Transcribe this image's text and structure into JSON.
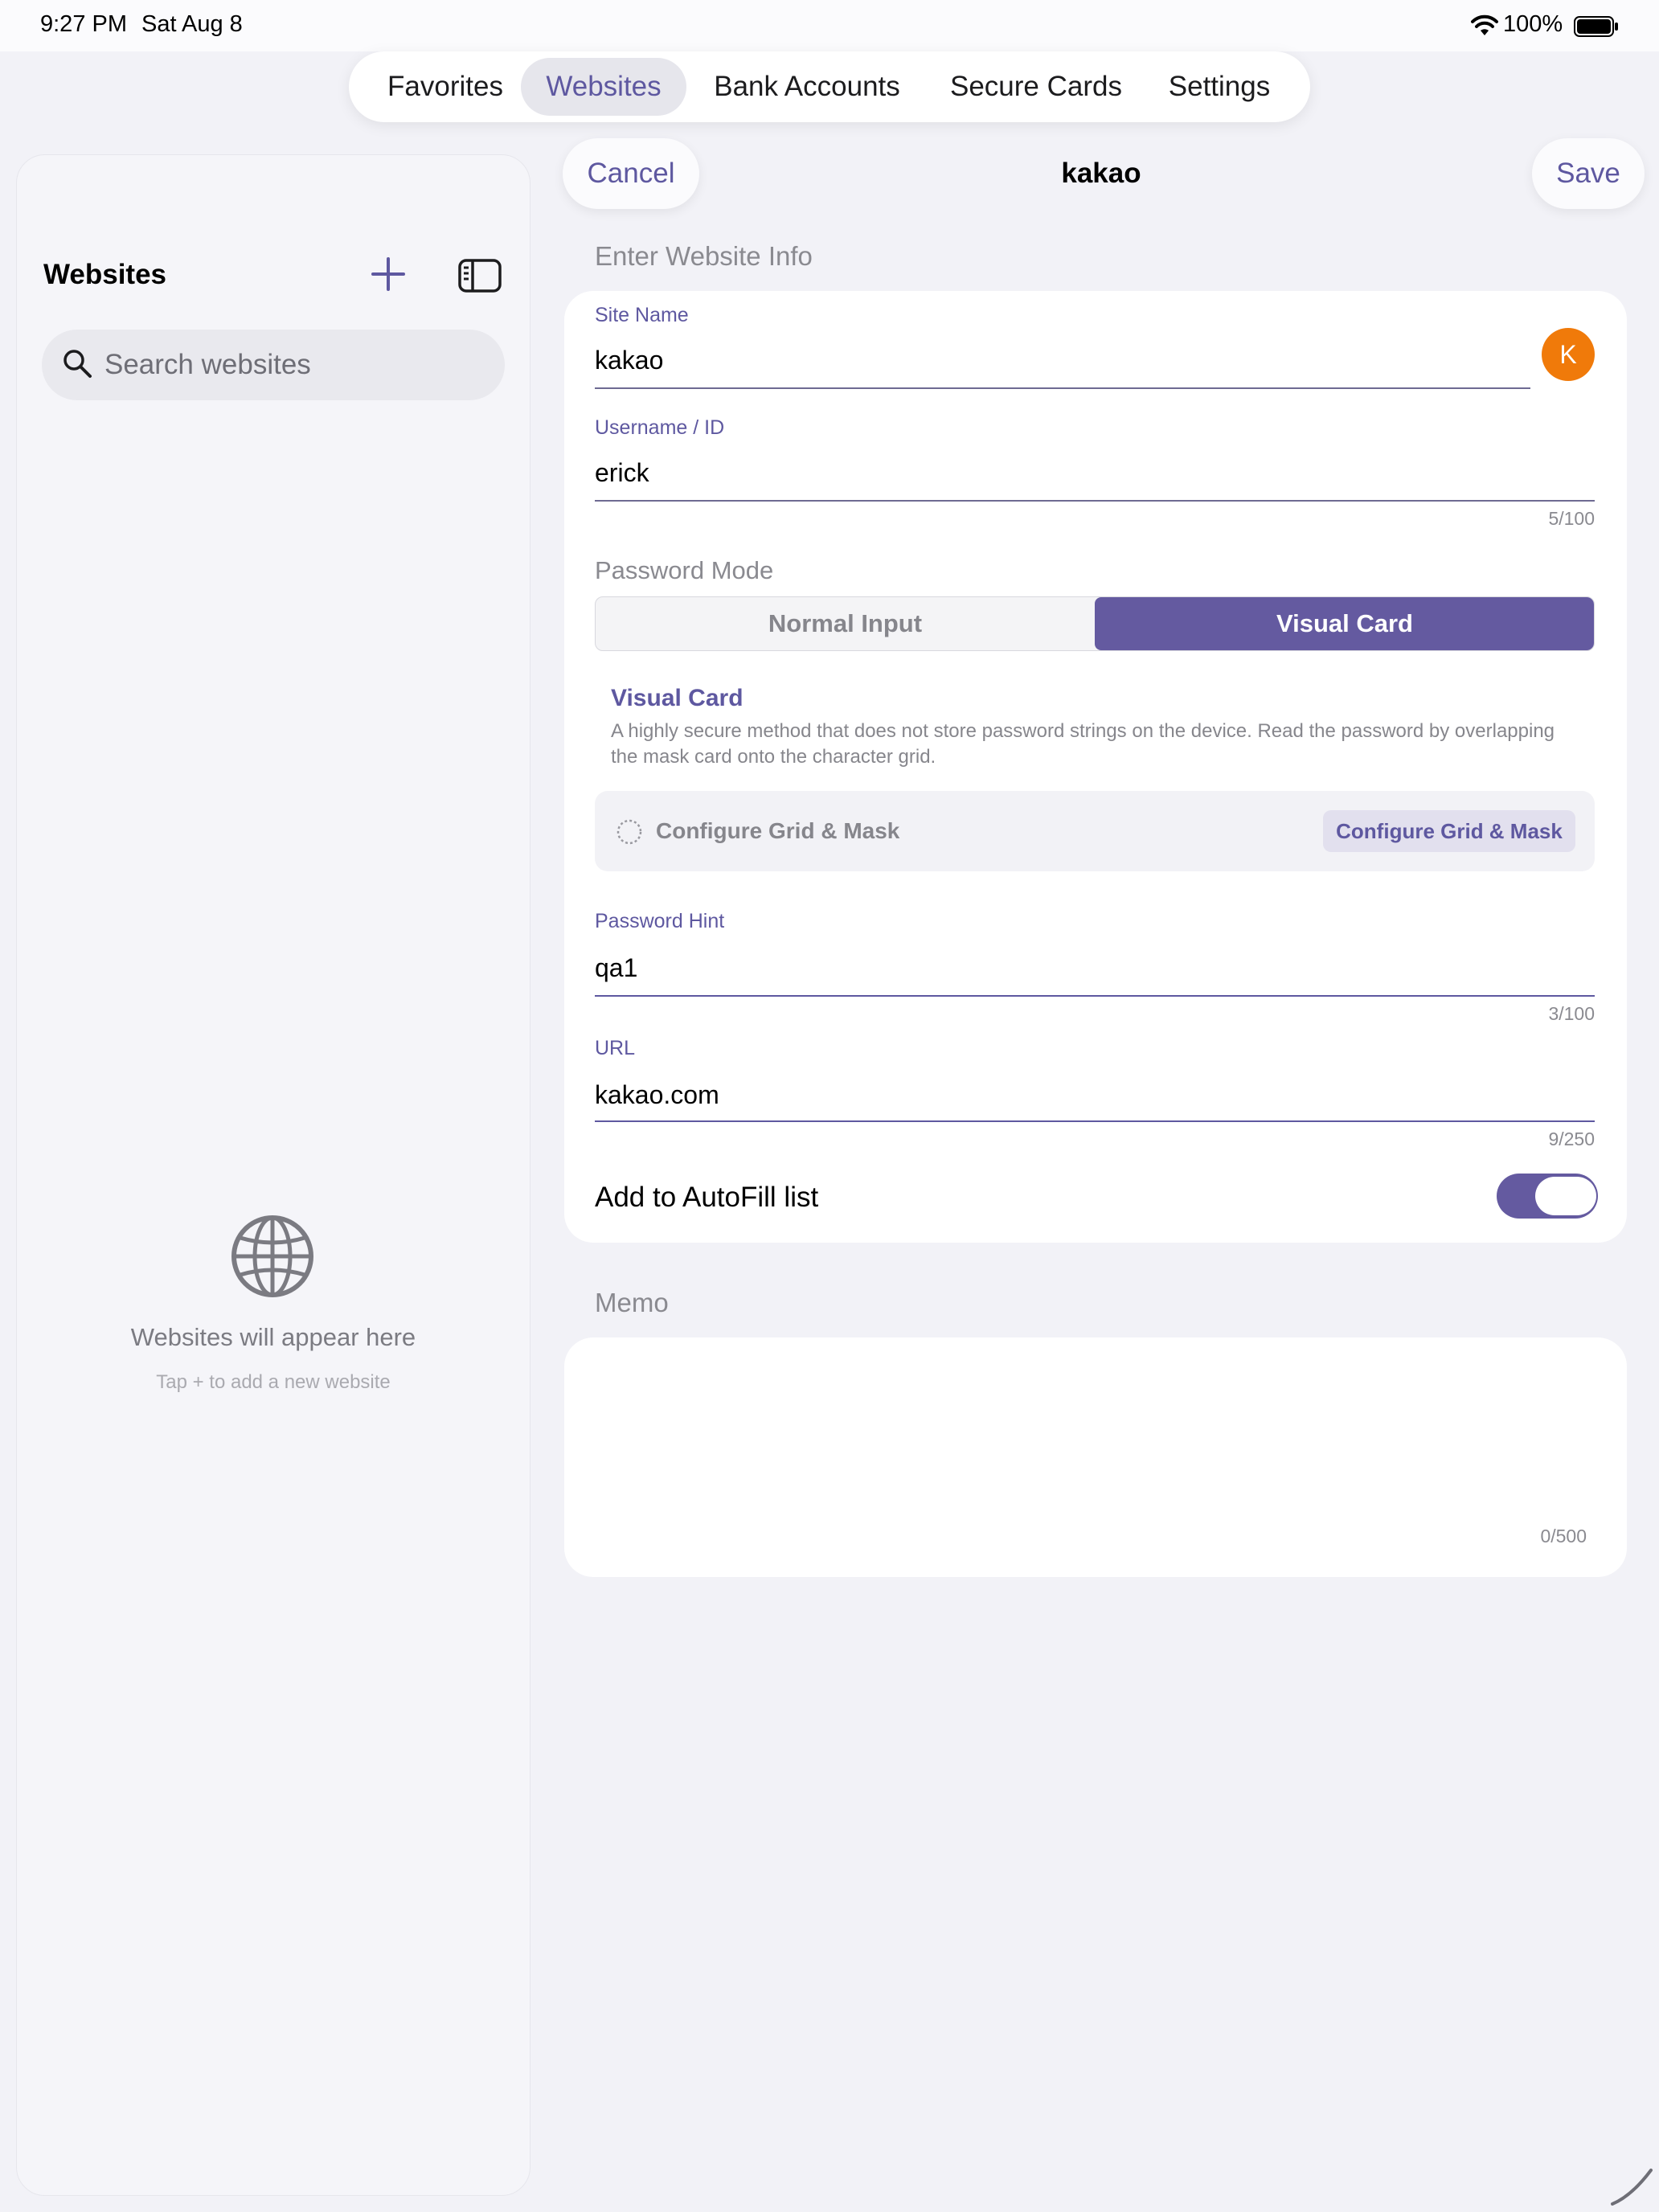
{
  "status_bar": {
    "time": "9:27 PM",
    "date": "Sat Aug 8",
    "battery": "100%",
    "wifi_icon": "wifi-icon",
    "battery_icon": "battery-full-icon"
  },
  "tabs": [
    {
      "label": "Favorites",
      "active": false
    },
    {
      "label": "Websites",
      "active": true
    },
    {
      "label": "Bank Accounts",
      "active": false
    },
    {
      "label": "Secure Cards",
      "active": false
    },
    {
      "label": "Settings",
      "active": false
    }
  ],
  "sidebar": {
    "title": "Websites",
    "add_icon": "plus-icon",
    "toggle_icon": "sidebar-toggle-icon",
    "search_placeholder": "Search websites",
    "empty_icon": "globe-icon",
    "empty_title": "Websites will appear here",
    "empty_subtitle": "Tap + to add a new website"
  },
  "nav": {
    "cancel_label": "Cancel",
    "title": "kakao",
    "save_label": "Save"
  },
  "form": {
    "section_title": "Enter Website Info",
    "site_name": {
      "label": "Site Name",
      "value": "kakao",
      "avatar_letter": "K"
    },
    "username": {
      "label": "Username / ID",
      "value": "erick",
      "counter": "5/100"
    },
    "password_mode": {
      "label": "Password Mode",
      "options": [
        "Normal Input",
        "Visual Card"
      ],
      "selected": "Visual Card"
    },
    "visual_card": {
      "title": "Visual Card",
      "description": "A highly secure method that does not store password strings on the device. Read the password by overlapping the mask card onto the character grid.",
      "status_label": "Configure Grid & Mask",
      "button_label": "Configure Grid & Mask"
    },
    "password_hint": {
      "label": "Password Hint",
      "value": "qa1",
      "counter": "3/100"
    },
    "url": {
      "label": "URL",
      "value": "kakao.com",
      "counter": "9/250"
    },
    "autofill": {
      "label": "Add to AutoFill list",
      "enabled": true
    }
  },
  "memo": {
    "section_title": "Memo",
    "value": "",
    "counter": "0/500"
  },
  "colors": {
    "accent": "#5e58a0",
    "segment_selected": "#645aa0",
    "avatar": "#f07a0a",
    "background": "#f2f2f7"
  }
}
